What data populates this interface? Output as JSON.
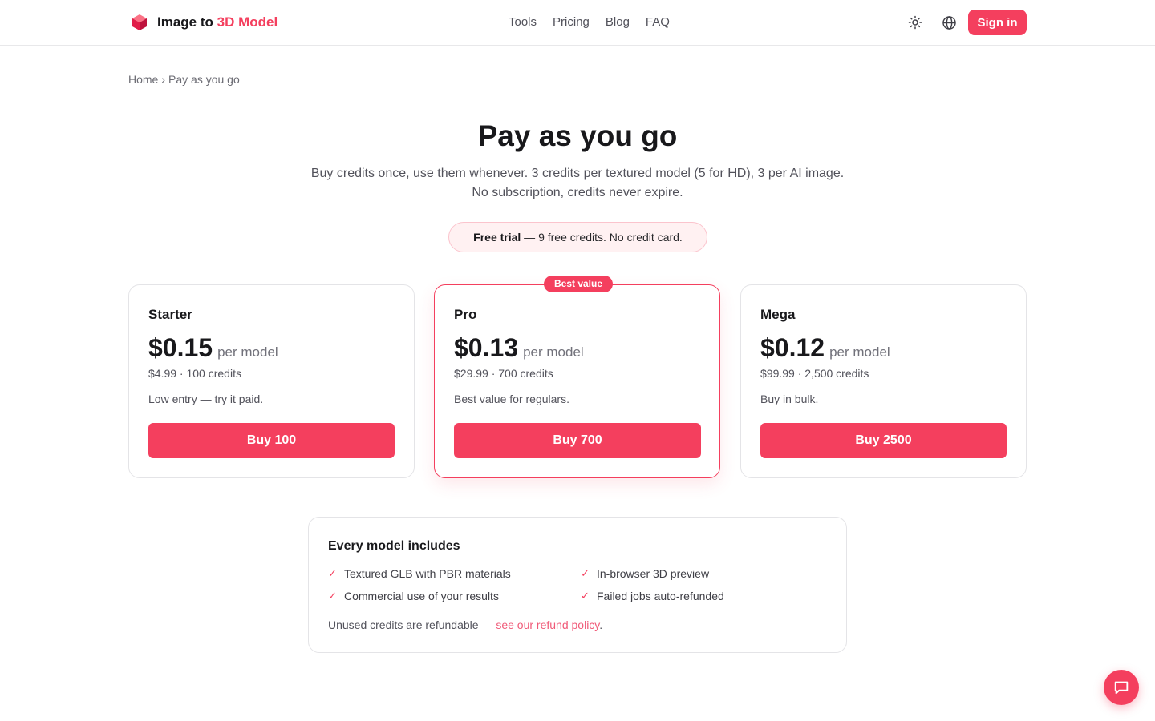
{
  "brand": {
    "name_prefix": "Image to",
    "name_accent": "3D Model",
    "colors": {
      "accent": "#f43f5e",
      "text": "#18181b",
      "muted": "#52525b"
    }
  },
  "nav": {
    "items": [
      {
        "label": "Tools"
      },
      {
        "label": "Pricing"
      },
      {
        "label": "Blog"
      },
      {
        "label": "FAQ"
      }
    ]
  },
  "header": {
    "icons": [
      "sun-icon",
      "globe-icon"
    ],
    "signin_label": "Sign in"
  },
  "breadcrumb": {
    "home": "Home",
    "separator": "›",
    "current": "Pay as you go"
  },
  "hero": {
    "title": "Pay as you go",
    "subtitle": "Buy credits once, use them whenever. 3 credits per textured model (5 for HD), 3 per AI image. No subscription, credits never expire.",
    "trial_bold": "Free trial",
    "trial_text": " — 9 free credits. No credit card."
  },
  "plans": [
    {
      "name": "Starter",
      "price": "$0.15",
      "per": "per model",
      "meta": "$4.99 · 100 credits",
      "desc": "Low entry — try it paid.",
      "button": "Buy 100"
    },
    {
      "name": "Pro",
      "price": "$0.13",
      "per": "per model",
      "meta": "$29.99 · 700 credits",
      "desc": "Best value for regulars.",
      "button": "Buy 700",
      "badge": "Best value"
    },
    {
      "name": "Mega",
      "price": "$0.12",
      "per": "per model",
      "meta": "$99.99 · 2,500 credits",
      "desc": "Buy in bulk.",
      "button": "Buy 2500"
    }
  ],
  "includes": {
    "title": "Every model includes",
    "check": "✓",
    "features": [
      "Textured GLB with PBR materials",
      "In-browser 3D preview",
      "Commercial use of your results",
      "Failed jobs auto-refunded"
    ],
    "refund_text": "Unused credits are refundable — ",
    "refund_link": "see our refund policy",
    "refund_end": "."
  },
  "chat": {
    "icon": "chat-bubble-icon"
  }
}
